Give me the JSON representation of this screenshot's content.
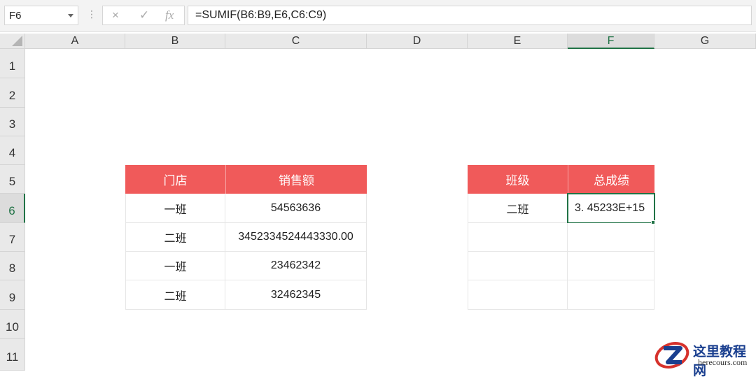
{
  "formula_bar": {
    "name_box": "F6",
    "dots": "⋮",
    "cancel_icon": "×",
    "enter_icon": "✓",
    "fx_label": "fx",
    "formula": "=SUMIF(B6:B9,E6,C6:C9)"
  },
  "columns": [
    "A",
    "B",
    "C",
    "D",
    "E",
    "F",
    "G"
  ],
  "rows": [
    "1",
    "2",
    "3",
    "4",
    "5",
    "6",
    "7",
    "8",
    "9",
    "10",
    "11"
  ],
  "selected_cell": "F6",
  "sales_table": {
    "headers": [
      "门店",
      "销售额"
    ],
    "rows": [
      [
        "一班",
        "54563636"
      ],
      [
        "二班",
        "3452334524443330.00"
      ],
      [
        "一班",
        "23462342"
      ],
      [
        "二班",
        "32462345"
      ]
    ]
  },
  "summary_table": {
    "headers": [
      "班级",
      "总成绩"
    ],
    "rows": [
      [
        "二班",
        "3. 45233E+15"
      ],
      [
        "",
        ""
      ],
      [
        "",
        ""
      ],
      [
        "",
        ""
      ]
    ]
  },
  "watermark": {
    "title": "这里教程网",
    "url": "herecours.com"
  },
  "colors": {
    "table_header": "#f05a5a",
    "selection": "#217346",
    "watermark_blue": "#1a3f8f",
    "watermark_red": "#d6322c"
  }
}
